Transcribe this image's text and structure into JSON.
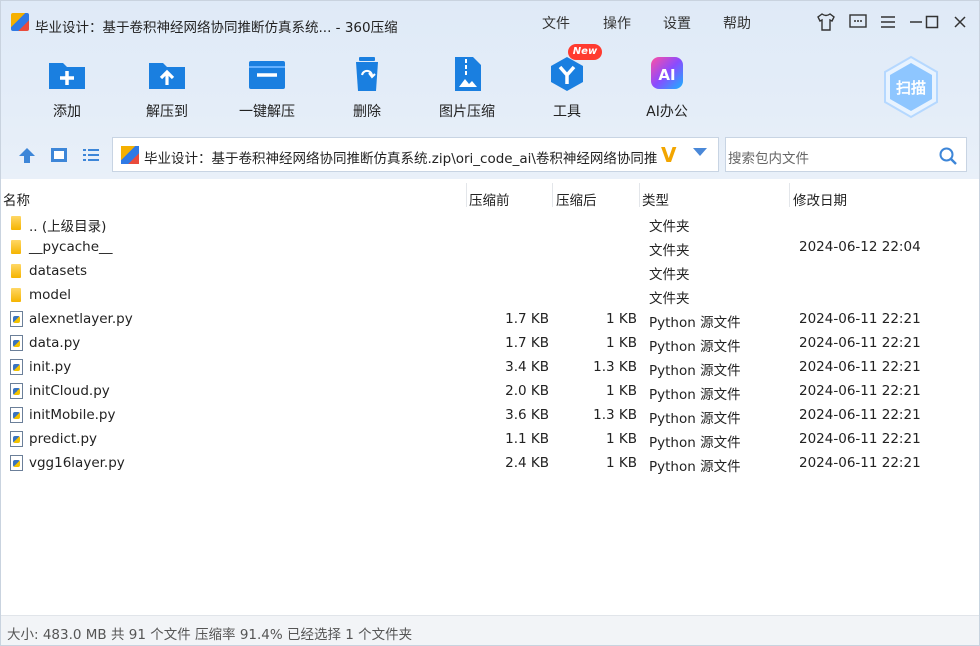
{
  "window": {
    "title": "毕业设计：基于卷积神经网络协同推断仿真系统... - 360压缩",
    "menu": [
      "文件",
      "操作",
      "设置",
      "帮助"
    ]
  },
  "toolbar": {
    "buttons": [
      {
        "label": "添加",
        "icon": "add-icon"
      },
      {
        "label": "解压到",
        "icon": "extract-icon"
      },
      {
        "label": "一键解压",
        "icon": "one-click-extract-icon"
      },
      {
        "label": "删除",
        "icon": "delete-icon"
      },
      {
        "label": "图片压缩",
        "icon": "image-compress-icon"
      },
      {
        "label": "工具",
        "icon": "tools-icon"
      },
      {
        "label": "AI办公",
        "icon": "ai-office-icon"
      }
    ],
    "new_badge": "New",
    "scan_label": "扫描"
  },
  "address": {
    "path": "毕业设计：基于卷积神经网络协同推断仿真系统.zip\\ori_code_ai\\卷积神经网络协同推",
    "search_placeholder": "搜索包内文件"
  },
  "columns": [
    "名称",
    "压缩前",
    "压缩后",
    "类型",
    "修改日期"
  ],
  "files": [
    {
      "name": ".. (上级目录)",
      "size": "",
      "packed": "",
      "type": "文件夹",
      "date": "",
      "kind": "folder"
    },
    {
      "name": "__pycache__",
      "size": "",
      "packed": "",
      "type": "文件夹",
      "date": "2024-06-12 22:04",
      "kind": "folder"
    },
    {
      "name": "datasets",
      "size": "",
      "packed": "",
      "type": "文件夹",
      "date": "",
      "kind": "folder"
    },
    {
      "name": "model",
      "size": "",
      "packed": "",
      "type": "文件夹",
      "date": "",
      "kind": "folder"
    },
    {
      "name": "alexnetlayer.py",
      "size": "1.7 KB",
      "packed": "1 KB",
      "type": "Python 源文件",
      "date": "2024-06-11 22:21",
      "kind": "py"
    },
    {
      "name": "data.py",
      "size": "1.7 KB",
      "packed": "1 KB",
      "type": "Python 源文件",
      "date": "2024-06-11 22:21",
      "kind": "py"
    },
    {
      "name": "init.py",
      "size": "3.4 KB",
      "packed": "1.3 KB",
      "type": "Python 源文件",
      "date": "2024-06-11 22:21",
      "kind": "py"
    },
    {
      "name": "initCloud.py",
      "size": "2.0 KB",
      "packed": "1 KB",
      "type": "Python 源文件",
      "date": "2024-06-11 22:21",
      "kind": "py"
    },
    {
      "name": "initMobile.py",
      "size": "3.6 KB",
      "packed": "1.3 KB",
      "type": "Python 源文件",
      "date": "2024-06-11 22:21",
      "kind": "py"
    },
    {
      "name": "predict.py",
      "size": "1.1 KB",
      "packed": "1 KB",
      "type": "Python 源文件",
      "date": "2024-06-11 22:21",
      "kind": "py"
    },
    {
      "name": "vgg16layer.py",
      "size": "2.4 KB",
      "packed": "1 KB",
      "type": "Python 源文件",
      "date": "2024-06-11 22:21",
      "kind": "py"
    }
  ],
  "status": "大小: 483.0 MB 共 91 个文件 压缩率 91.4% 已经选择 1 个文件夹"
}
